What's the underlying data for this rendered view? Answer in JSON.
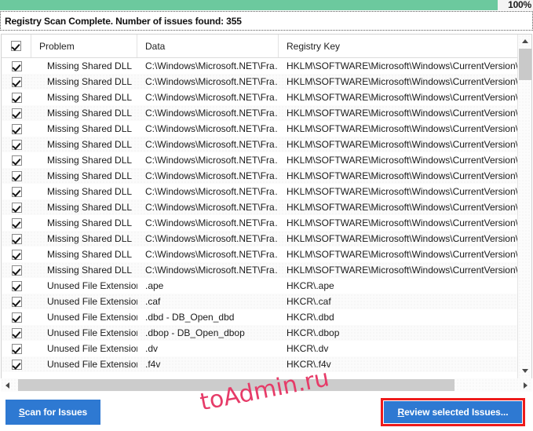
{
  "progress": {
    "percent_label": "100%",
    "value": 100,
    "fill_color": "#6cc99e"
  },
  "status": {
    "message": "Registry Scan Complete. Number of issues found: 355",
    "issues_found": 355
  },
  "listview": {
    "select_all_checked": true,
    "columns": [
      {
        "key": "checkbox",
        "label": ""
      },
      {
        "key": "problem",
        "label": "Problem"
      },
      {
        "key": "data",
        "label": "Data"
      },
      {
        "key": "registry_key",
        "label": "Registry Key"
      }
    ],
    "rows": [
      {
        "checked": true,
        "problem": "Missing Shared DLL",
        "data": "C:\\Windows\\Microsoft.NET\\Fra…",
        "registry_key": "HKLM\\SOFTWARE\\Microsoft\\Windows\\CurrentVersion\\Shared"
      },
      {
        "checked": true,
        "problem": "Missing Shared DLL",
        "data": "C:\\Windows\\Microsoft.NET\\Fra…",
        "registry_key": "HKLM\\SOFTWARE\\Microsoft\\Windows\\CurrentVersion\\Shared"
      },
      {
        "checked": true,
        "problem": "Missing Shared DLL",
        "data": "C:\\Windows\\Microsoft.NET\\Fra…",
        "registry_key": "HKLM\\SOFTWARE\\Microsoft\\Windows\\CurrentVersion\\Shared"
      },
      {
        "checked": true,
        "problem": "Missing Shared DLL",
        "data": "C:\\Windows\\Microsoft.NET\\Fra…",
        "registry_key": "HKLM\\SOFTWARE\\Microsoft\\Windows\\CurrentVersion\\Shared"
      },
      {
        "checked": true,
        "problem": "Missing Shared DLL",
        "data": "C:\\Windows\\Microsoft.NET\\Fra…",
        "registry_key": "HKLM\\SOFTWARE\\Microsoft\\Windows\\CurrentVersion\\Shared"
      },
      {
        "checked": true,
        "problem": "Missing Shared DLL",
        "data": "C:\\Windows\\Microsoft.NET\\Fra…",
        "registry_key": "HKLM\\SOFTWARE\\Microsoft\\Windows\\CurrentVersion\\Shared"
      },
      {
        "checked": true,
        "problem": "Missing Shared DLL",
        "data": "C:\\Windows\\Microsoft.NET\\Fra…",
        "registry_key": "HKLM\\SOFTWARE\\Microsoft\\Windows\\CurrentVersion\\Shared"
      },
      {
        "checked": true,
        "problem": "Missing Shared DLL",
        "data": "C:\\Windows\\Microsoft.NET\\Fra…",
        "registry_key": "HKLM\\SOFTWARE\\Microsoft\\Windows\\CurrentVersion\\Shared"
      },
      {
        "checked": true,
        "problem": "Missing Shared DLL",
        "data": "C:\\Windows\\Microsoft.NET\\Fra…",
        "registry_key": "HKLM\\SOFTWARE\\Microsoft\\Windows\\CurrentVersion\\Shared"
      },
      {
        "checked": true,
        "problem": "Missing Shared DLL",
        "data": "C:\\Windows\\Microsoft.NET\\Fra…",
        "registry_key": "HKLM\\SOFTWARE\\Microsoft\\Windows\\CurrentVersion\\Shared"
      },
      {
        "checked": true,
        "problem": "Missing Shared DLL",
        "data": "C:\\Windows\\Microsoft.NET\\Fra…",
        "registry_key": "HKLM\\SOFTWARE\\Microsoft\\Windows\\CurrentVersion\\Shared"
      },
      {
        "checked": true,
        "problem": "Missing Shared DLL",
        "data": "C:\\Windows\\Microsoft.NET\\Fra…",
        "registry_key": "HKLM\\SOFTWARE\\Microsoft\\Windows\\CurrentVersion\\Shared"
      },
      {
        "checked": true,
        "problem": "Missing Shared DLL",
        "data": "C:\\Windows\\Microsoft.NET\\Fra…",
        "registry_key": "HKLM\\SOFTWARE\\Microsoft\\Windows\\CurrentVersion\\Shared"
      },
      {
        "checked": true,
        "problem": "Missing Shared DLL",
        "data": "C:\\Windows\\Microsoft.NET\\Fra…",
        "registry_key": "HKLM\\SOFTWARE\\Microsoft\\Windows\\CurrentVersion\\Shared"
      },
      {
        "checked": true,
        "problem": "Unused File Extension",
        "data": ".ape",
        "registry_key": "HKCR\\.ape"
      },
      {
        "checked": true,
        "problem": "Unused File Extension",
        "data": ".caf",
        "registry_key": "HKCR\\.caf"
      },
      {
        "checked": true,
        "problem": "Unused File Extension",
        "data": ".dbd - DB_Open_dbd",
        "registry_key": "HKCR\\.dbd"
      },
      {
        "checked": true,
        "problem": "Unused File Extension",
        "data": ".dbop - DB_Open_dbop",
        "registry_key": "HKCR\\.dbop"
      },
      {
        "checked": true,
        "problem": "Unused File Extension",
        "data": ".dv",
        "registry_key": "HKCR\\.dv"
      },
      {
        "checked": true,
        "problem": "Unused File Extension",
        "data": ".f4v",
        "registry_key": "HKCR\\.f4v"
      }
    ]
  },
  "scrollbars": {
    "vertical": {
      "up_icon": "chevron-up-icon",
      "down_icon": "chevron-down-icon"
    },
    "horizontal": {
      "left_icon": "chevron-left-icon",
      "right_icon": "chevron-right-icon"
    }
  },
  "buttons": {
    "scan": {
      "accel": "S",
      "rest": "can for Issues",
      "full_label": "Scan for Issues",
      "color": "#2e79d2"
    },
    "review": {
      "accel": "R",
      "rest": "eview selected Issues...",
      "full_label": "Review selected Issues...",
      "color": "#2e79d2",
      "highlight_color": "#ee1b1b"
    }
  },
  "watermark": {
    "text": "toAdmin.ru",
    "color": "#e63b68"
  }
}
